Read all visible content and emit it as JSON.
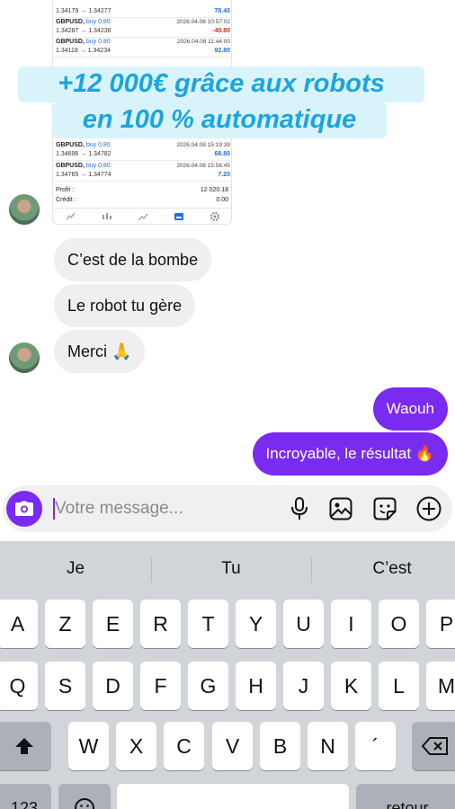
{
  "trade_card": {
    "rows": [
      {
        "symbol": "",
        "dir": "",
        "time": "",
        "prices": "1.34179 → 1.34277",
        "profit": "78.40",
        "negative": false
      },
      {
        "symbol": "GBPUSD,",
        "dir": "buy 0.80",
        "time": "2026.04.08 10:57:02",
        "prices": "1.34287 → 1.34236",
        "profit": "-40.80",
        "negative": true
      },
      {
        "symbol": "GBPUSD,",
        "dir": "buy 0.80",
        "time": "2026.04.08 11:44:00",
        "prices": "1.34118 → 1.34234",
        "profit": "92.80",
        "negative": false
      },
      {
        "symbol": "GBPUSD,",
        "dir": "buy 0.80",
        "time": "2026.04.08 15:19:39",
        "prices": "1.34696 → 1.34782",
        "profit": "68.80",
        "negative": false
      },
      {
        "symbol": "GBPUSD,",
        "dir": "buy 0.80",
        "time": "2026.04.08 15:56:45",
        "prices": "1.34765 → 1.34774",
        "profit": "7.20",
        "negative": false
      }
    ],
    "summary": [
      {
        "label": "Profit :",
        "value": "12 020.18"
      },
      {
        "label": "Crédit :",
        "value": "0.00"
      }
    ],
    "toolbar_icons": [
      "quotes-icon",
      "chart-icon",
      "trade-icon",
      "history-icon",
      "settings-icon"
    ]
  },
  "banner": {
    "line1": "+12 000€ grâce aux robots",
    "line2": "en 100 % automatique"
  },
  "messages": [
    {
      "side": "in",
      "text": "C’est de la bombe"
    },
    {
      "side": "in",
      "text": "Le robot tu gère"
    },
    {
      "side": "in",
      "text": "Merci 🙏"
    },
    {
      "side": "out",
      "text": "Waouh"
    },
    {
      "side": "out",
      "text": "Incroyable, le résultat 🔥"
    }
  ],
  "composer": {
    "placeholder": "Votre message...",
    "icons": [
      "camera-icon",
      "microphone-icon",
      "gallery-icon",
      "sticker-icon",
      "plus-icon"
    ]
  },
  "keyboard": {
    "suggestions": [
      "Je",
      "Tu",
      "C’est"
    ],
    "row1": [
      "A",
      "Z",
      "E",
      "R",
      "T",
      "Y",
      "U",
      "I",
      "O",
      "P"
    ],
    "row2": [
      "Q",
      "S",
      "D",
      "F",
      "G",
      "H",
      "J",
      "K",
      "L",
      "M"
    ],
    "row3": [
      "W",
      "X",
      "C",
      "V",
      "B",
      "N",
      "´"
    ],
    "numbers_label": "123",
    "return_label": "retour"
  },
  "colors": {
    "accent": "#7a2bf0",
    "banner_text": "#1aa5df",
    "banner_bg": "#d9f3fb",
    "profit_positive": "#1f6fd6",
    "profit_negative": "#dd2222",
    "incoming_bubble": "#efefef",
    "keyboard_bg": "#d1d4d9"
  }
}
